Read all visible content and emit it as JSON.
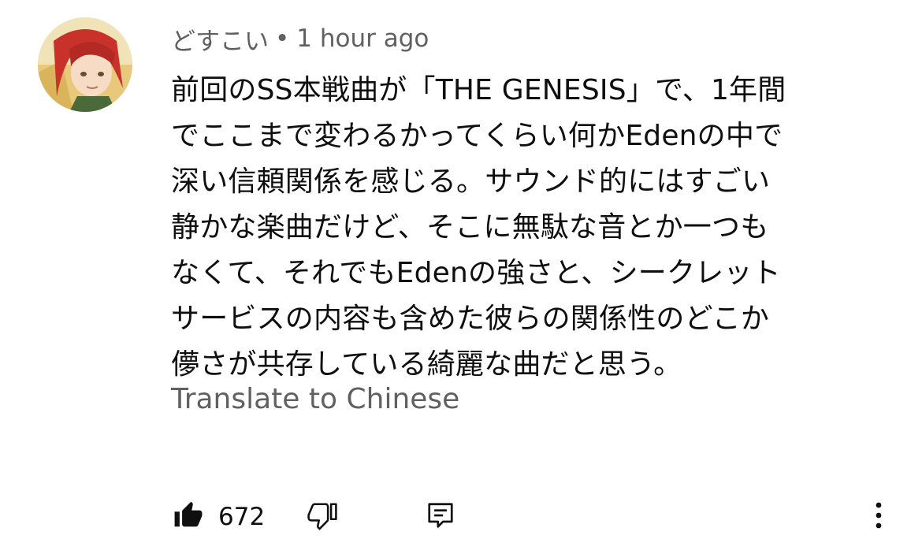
{
  "comment": {
    "author": "どすこい",
    "separator": "•",
    "timestamp": "1 hour ago",
    "text_lines": [
      "前回のSS本戦曲が「THE GENESIS」で、1年間",
      "でここまで変わるかってくらい何かEdenの中で",
      "深い信頼関係を感じる。サウンド的にはすごい",
      "静かな楽曲だけど、そこに無駄な音とか一つも",
      "なくて、それでもEdenの強さと、シークレット",
      "サービスの内容も含めた彼らの関係性のどこか",
      "儚さが共存している綺麗な曲だと思う。"
    ],
    "translate_label": "Translate to Chinese",
    "like_count": "672"
  },
  "icons": {
    "avatar": "avatar-image",
    "like": "thumbs-up-filled-icon",
    "dislike": "thumbs-down-outline-icon",
    "reply": "reply-comment-icon",
    "more": "more-vertical-icon"
  },
  "colors": {
    "primary_text": "#0f0f0f",
    "secondary_text": "#606060",
    "background": "#ffffff"
  }
}
